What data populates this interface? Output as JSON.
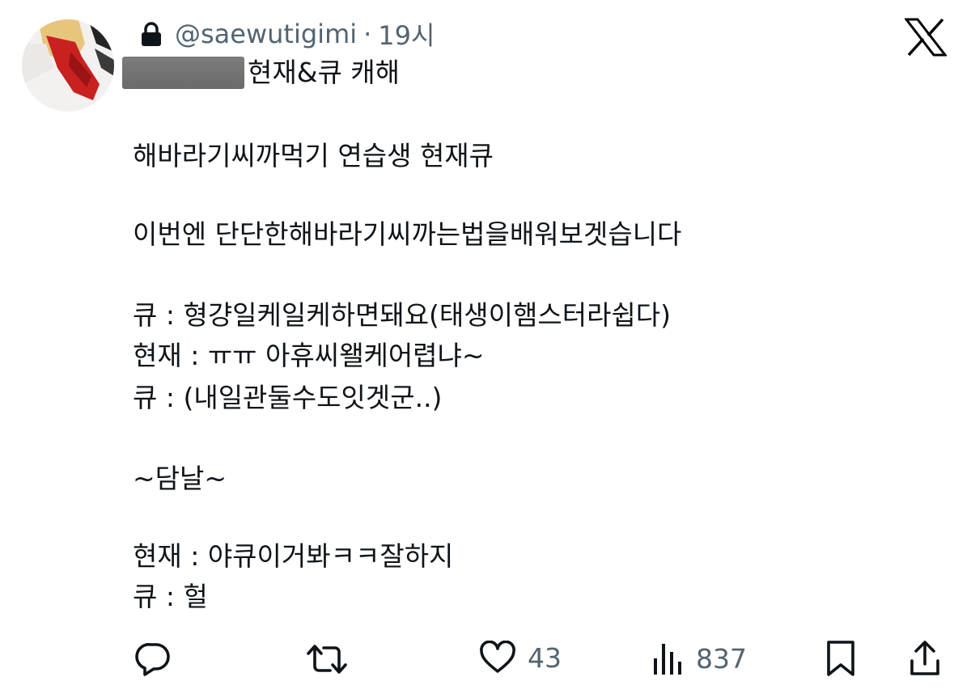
{
  "tweet": {
    "handle": "@saewutigimi",
    "separator": "·",
    "time": "19시",
    "reply_to": "현재&큐 캐해",
    "lines": [
      "해바라기씨까먹기 연습생 현재큐",
      "이번엔 단단한해바라기씨까는법을배워보겟습니다",
      "큐 : 형걍일케일케하면돼요(태생이햄스터라쉽다)",
      "현재 : ㅠㅠ 아휴씨왤케어렵냐~",
      "큐 : (내일관둘수도잇겟군..)",
      "~담날~",
      "현재 : 야큐이거봐ㅋㅋ잘하지",
      "큐 : 헐"
    ]
  },
  "actions": {
    "reply": {
      "icon": "reply-icon"
    },
    "retweet": {
      "icon": "retweet-icon"
    },
    "like": {
      "icon": "heart-icon",
      "count": "43"
    },
    "views": {
      "icon": "views-chart-icon",
      "count": "837"
    },
    "bookmark": {
      "icon": "bookmark-icon"
    },
    "share": {
      "icon": "share-icon"
    }
  },
  "colors": {
    "text": "#0f1419",
    "secondary": "#536471",
    "redaction": "#737373"
  }
}
